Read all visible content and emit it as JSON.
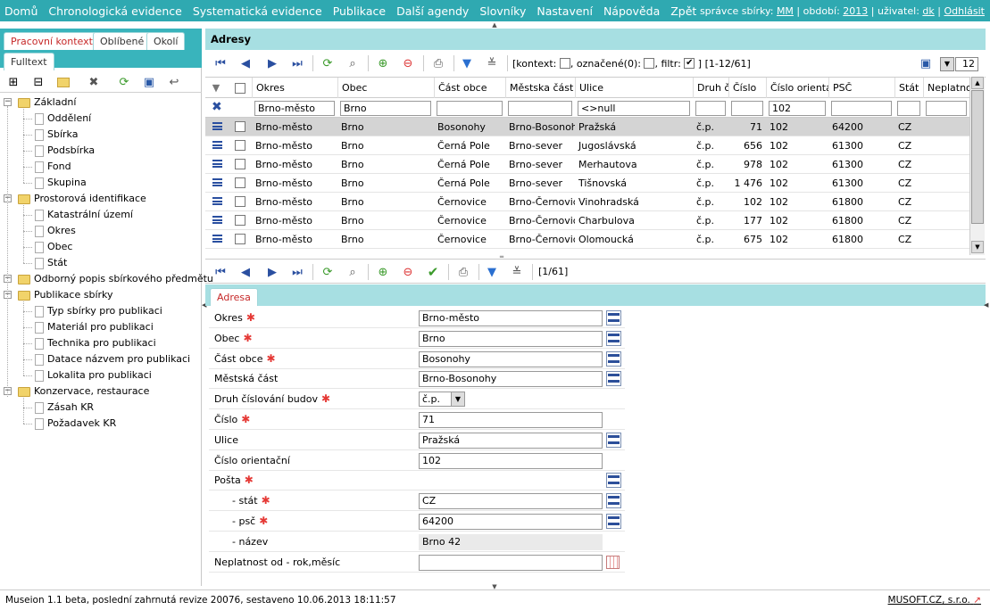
{
  "topbar": {
    "menu": [
      "Domů",
      "Chronologická evidence",
      "Systematická evidence",
      "Publikace",
      "Další agendy",
      "Slovníky",
      "Nastavení",
      "Nápověda",
      "Zpět"
    ],
    "admin_label": "správce sbírky:",
    "admin_value": "MM",
    "period_label": "| období:",
    "period_value": "2013",
    "user_label": "| uživatel:",
    "user_value": "dk",
    "logout": "Odhlásit"
  },
  "lefttabs": [
    "Pracovní kontext",
    "Oblíbené",
    "Okolí",
    "Fulltext"
  ],
  "tree": [
    {
      "label": "Základní",
      "type": "folder",
      "level": 0
    },
    {
      "label": "Oddělení",
      "type": "doc",
      "level": 1
    },
    {
      "label": "Sbírka",
      "type": "doc",
      "level": 1
    },
    {
      "label": "Podsbírka",
      "type": "doc",
      "level": 1
    },
    {
      "label": "Fond",
      "type": "doc",
      "level": 1
    },
    {
      "label": "Skupina",
      "type": "doc",
      "level": 1
    },
    {
      "label": "Prostorová identifikace",
      "type": "folder",
      "level": 0
    },
    {
      "label": "Katastrální území",
      "type": "doc",
      "level": 1
    },
    {
      "label": "Okres",
      "type": "doc",
      "level": 1
    },
    {
      "label": "Obec",
      "type": "doc",
      "level": 1
    },
    {
      "label": "Stát",
      "type": "doc",
      "level": 1
    },
    {
      "label": "Odborný popis sbírkového předmětu",
      "type": "folder",
      "level": 0
    },
    {
      "label": "Publikace sbírky",
      "type": "folder",
      "level": 0
    },
    {
      "label": "Typ sbírky pro publikaci",
      "type": "doc",
      "level": 1
    },
    {
      "label": "Materiál pro publikaci",
      "type": "doc",
      "level": 1
    },
    {
      "label": "Technika pro publikaci",
      "type": "doc",
      "level": 1
    },
    {
      "label": "Datace názvem pro publikaci",
      "type": "doc",
      "level": 1
    },
    {
      "label": "Lokalita pro publikaci",
      "type": "doc",
      "level": 1
    },
    {
      "label": "Konzervace, restaurace",
      "type": "folder",
      "level": 0
    },
    {
      "label": "Zásah KR",
      "type": "doc",
      "level": 1
    },
    {
      "label": "Požadavek KR",
      "type": "doc",
      "level": 1
    }
  ],
  "main": {
    "title": "Adresy",
    "context_text": "[kontext:",
    "marked_text": ", označené(0):",
    "filter_text": ", filtr:",
    "range_text": "] [1-12/61]",
    "page_size": "12",
    "bottom_range": "[1/61]"
  },
  "grid": {
    "columns": [
      "Okres",
      "Obec",
      "Část obce",
      "Městska část",
      "Ulice",
      "Druh či",
      "Číslo",
      "Číslo orientač",
      "PSČ",
      "Stát",
      "Neplatnos"
    ],
    "filters": [
      "Brno-město",
      "Brno",
      "",
      "",
      "<>null",
      "",
      "",
      "102",
      "",
      "",
      ""
    ],
    "rows": [
      [
        "Brno-město",
        "Brno",
        "Bosonohy",
        "Brno-Bosonohy",
        "Pražská",
        "č.p.",
        "71",
        "102",
        "64200",
        "CZ"
      ],
      [
        "Brno-město",
        "Brno",
        "Černá Pole",
        "Brno-sever",
        "Jugoslávská",
        "č.p.",
        "656",
        "102",
        "61300",
        "CZ"
      ],
      [
        "Brno-město",
        "Brno",
        "Černá Pole",
        "Brno-sever",
        "Merhautova",
        "č.p.",
        "978",
        "102",
        "61300",
        "CZ"
      ],
      [
        "Brno-město",
        "Brno",
        "Černá Pole",
        "Brno-sever",
        "Tišnovská",
        "č.p.",
        "1 476",
        "102",
        "61300",
        "CZ"
      ],
      [
        "Brno-město",
        "Brno",
        "Černovice",
        "Brno-Černovice",
        "Vinohradská",
        "č.p.",
        "102",
        "102",
        "61800",
        "CZ"
      ],
      [
        "Brno-město",
        "Brno",
        "Černovice",
        "Brno-Černovice",
        "Charbulova",
        "č.p.",
        "177",
        "102",
        "61800",
        "CZ"
      ],
      [
        "Brno-město",
        "Brno",
        "Černovice",
        "Brno-Černovice",
        "Olomoucká",
        "č.p.",
        "675",
        "102",
        "61800",
        "CZ"
      ]
    ]
  },
  "form": {
    "tab": "Adresa",
    "fields": [
      {
        "label": "Okres",
        "required": true,
        "value": "Brno-město",
        "lookup": true
      },
      {
        "label": "Obec",
        "required": true,
        "value": "Brno",
        "lookup": true
      },
      {
        "label": "Část obce",
        "required": true,
        "value": "Bosonohy",
        "lookup": true
      },
      {
        "label": "Městská část",
        "required": false,
        "value": "Brno-Bosonohy",
        "lookup": true
      },
      {
        "label": "Druh číslování budov",
        "required": true,
        "value": "č.p.",
        "select": true
      },
      {
        "label": "Číslo",
        "required": true,
        "value": "71"
      },
      {
        "label": "Ulice",
        "required": false,
        "value": "Pražská",
        "lookup": true
      },
      {
        "label": "Číslo orientační",
        "required": false,
        "value": "102"
      },
      {
        "label": "Pošta",
        "required": true,
        "value": null,
        "lookup": true
      },
      {
        "label": "- stát",
        "required": true,
        "value": "CZ",
        "lookup": true,
        "indent": true
      },
      {
        "label": "- psč",
        "required": true,
        "value": "64200",
        "lookup": true,
        "indent": true
      },
      {
        "label": "- název",
        "required": false,
        "value": "Brno 42",
        "readonly": true,
        "indent": true
      },
      {
        "label": "Neplatnost od - rok,měsíc",
        "required": false,
        "value": "",
        "calendar": true
      }
    ]
  },
  "status": {
    "left": "Museion 1.1 beta, poslední zahrnutá revize 20076, sestaveno 10.06.2013 18:11:57",
    "right": "MUSOFT.CZ, s.r.o."
  }
}
